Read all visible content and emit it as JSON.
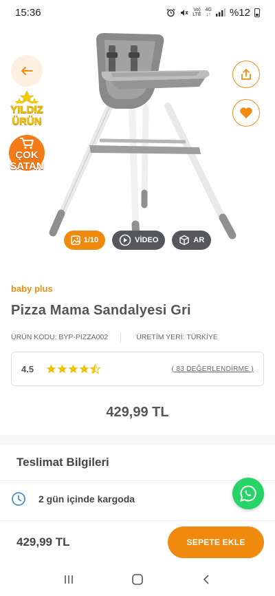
{
  "status_bar": {
    "time": "15:36",
    "network": "4G",
    "lte": "LTE",
    "volte": "Vo)",
    "battery": "%12"
  },
  "badges": {
    "star_line1": "YILDIZ",
    "star_line2": "ÜRÜN",
    "sell_line1": "ÇOK",
    "sell_line2": "SATAN"
  },
  "media": {
    "gallery_count": "1/10",
    "video_label": "VİDEO",
    "ar_label": "AR"
  },
  "product": {
    "brand": "baby plus",
    "title": "Pizza Mama Sandalyesi Gri",
    "code_text": "ÜRÜN KODU: BYP-PIZZA002",
    "origin_text": "ÜRETİM YERİ: TÜRKİYE",
    "rating": "4.5",
    "rating_value": 4.5,
    "reviews_link": "( 83 DEĞERLENDİRME )",
    "price": "429,99 TL"
  },
  "delivery": {
    "title": "Teslimat Bilgileri",
    "shipping_text": "2 gün içinde kargoda"
  },
  "bottom_bar": {
    "price": "429,99 TL",
    "add_to_cart": "SEPETE EKLE"
  },
  "colors": {
    "accent": "#f08a0f",
    "whatsapp": "#25d366",
    "star": "#f6c000",
    "text": "#444444"
  },
  "icons": [
    "back-arrow-icon",
    "share-icon",
    "heart-icon",
    "image-icon",
    "play-icon",
    "cube-icon",
    "star-icon",
    "clock-icon",
    "whatsapp-icon",
    "recents-icon",
    "home-icon",
    "back-icon"
  ]
}
